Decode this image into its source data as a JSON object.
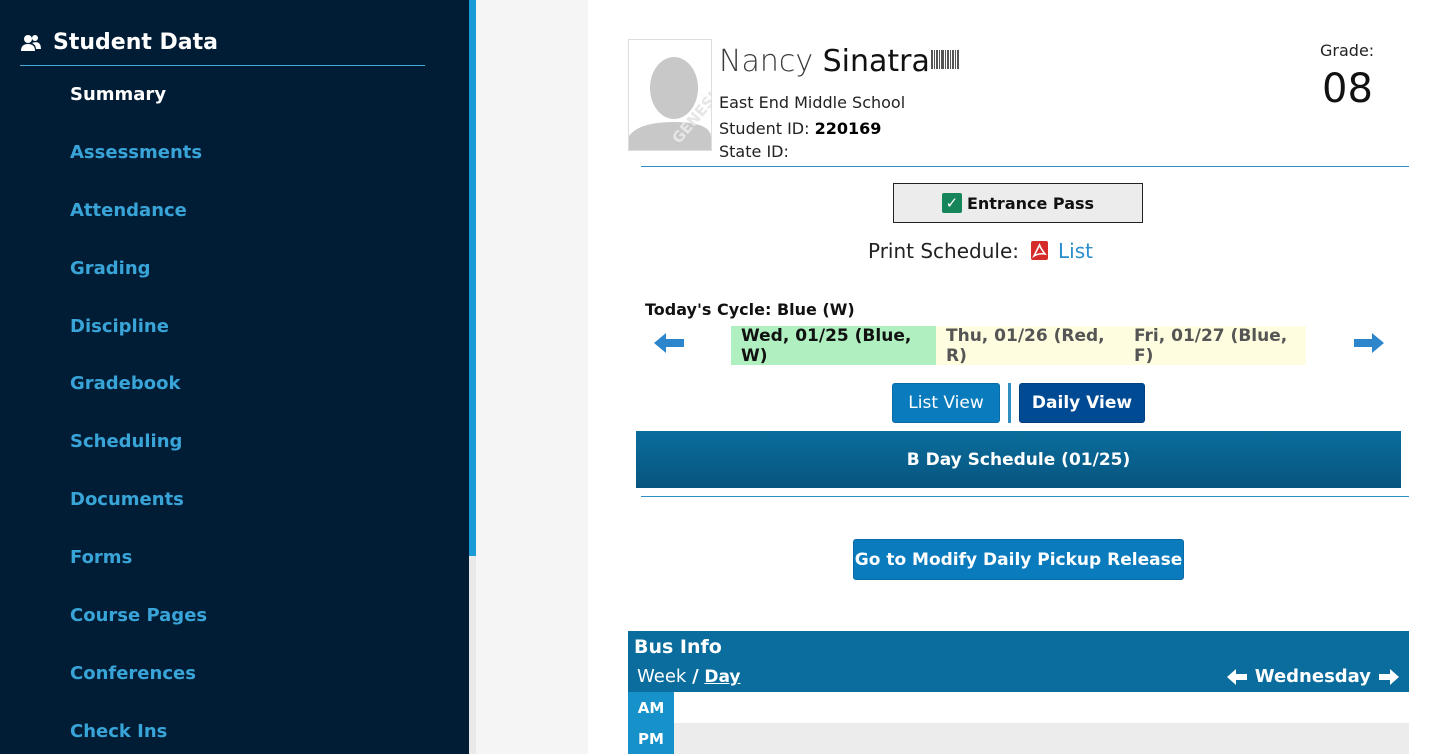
{
  "sidebar": {
    "title": "Student Data",
    "items": [
      {
        "label": "Summary",
        "active": true
      },
      {
        "label": "Assessments"
      },
      {
        "label": "Attendance"
      },
      {
        "label": "Grading"
      },
      {
        "label": "Discipline"
      },
      {
        "label": "Gradebook"
      },
      {
        "label": "Scheduling"
      },
      {
        "label": "Documents"
      },
      {
        "label": "Forms"
      },
      {
        "label": "Course Pages"
      },
      {
        "label": "Conferences"
      },
      {
        "label": "Check Ins"
      }
    ]
  },
  "student": {
    "first_name": "Nancy",
    "last_name": "Sinatra",
    "school": "East End Middle School",
    "student_id_label": "Student ID:",
    "student_id": "220169",
    "state_id_label": "State ID:",
    "state_id": "",
    "grade_label": "Grade:",
    "grade": "08",
    "photo_watermark": "GENESIS"
  },
  "entrance_pass": {
    "label": "Entrance Pass"
  },
  "print_schedule": {
    "label": "Print Schedule:",
    "link": "List"
  },
  "cycle": {
    "label": "Today's Cycle:",
    "value": "Blue (W)"
  },
  "days": [
    {
      "label": "Wed, 01/25 (Blue, W)",
      "selected": true
    },
    {
      "label": "Thu, 01/26 (Red, R)"
    },
    {
      "label": "Fri, 01/27 (Blue, F)"
    }
  ],
  "views": {
    "list": "List View",
    "daily": "Daily View"
  },
  "schedule_header": "B Day Schedule (01/25)",
  "pickup_button": "Go to Modify Daily Pickup Release",
  "bus": {
    "title": "Bus Info",
    "week": "Week",
    "slash": "/",
    "day": "Day",
    "current_day": "Wednesday",
    "am_label": "AM",
    "pm_label": "PM"
  },
  "colors": {
    "sidebar_bg": "#001d35",
    "accent": "#38a4d8",
    "header_bar": "#0a6d9e",
    "selected_day": "#b0f0c0",
    "other_day": "#fefde0"
  }
}
